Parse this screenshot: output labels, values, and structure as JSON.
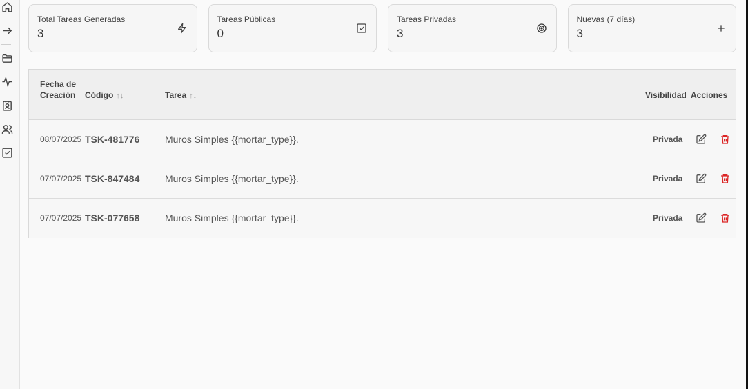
{
  "sidebar": {
    "icons": [
      "home-icon",
      "arrow-right-icon",
      "folder-icon",
      "activity-icon",
      "contact-icon",
      "users-icon",
      "checkbox-icon"
    ]
  },
  "stats": [
    {
      "title": "Total Tareas Generadas",
      "value": "3",
      "icon": "lightning-icon"
    },
    {
      "title": "Tareas Públicas",
      "value": "0",
      "icon": "check-square-icon"
    },
    {
      "title": "Tareas Privadas",
      "value": "3",
      "icon": "target-icon"
    },
    {
      "title": "Nuevas (7 días)",
      "value": "3",
      "icon": "plus-icon"
    }
  ],
  "table": {
    "headers": {
      "fecha": "Fecha de Creación",
      "codigo": "Código",
      "tarea": "Tarea",
      "visibilidad": "Visibilidad",
      "acciones": "Acciones"
    },
    "sort_glyph": "↑↓",
    "rows": [
      {
        "fecha": "08/07/2025",
        "codigo": "TSK-481776",
        "tarea": "Muros Simples {{mortar_type}}.",
        "visibilidad": "Privada"
      },
      {
        "fecha": "07/07/2025",
        "codigo": "TSK-847484",
        "tarea": "Muros Simples {{mortar_type}}.",
        "visibilidad": "Privada"
      },
      {
        "fecha": "07/07/2025",
        "codigo": "TSK-077658",
        "tarea": "Muros Simples {{mortar_type}}.",
        "visibilidad": "Privada"
      }
    ]
  },
  "colors": {
    "delete": "#dc2626",
    "text": "#555555",
    "border": "#d9d9d9"
  }
}
